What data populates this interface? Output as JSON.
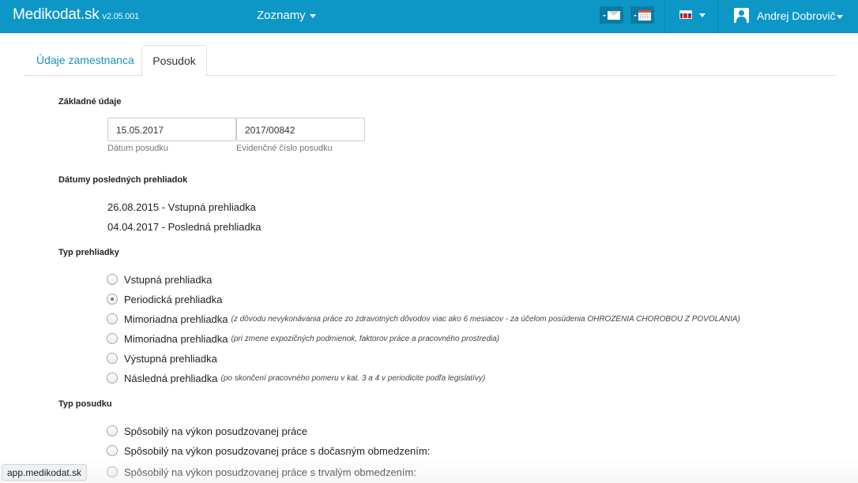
{
  "navbar": {
    "brand": "Medikodat.sk",
    "version": "v2.05.001",
    "menu_label": "Zoznamy",
    "mail_badge": "-",
    "calendar_badge": "-",
    "user_name": "Andrej Dobrovič"
  },
  "tabs": [
    {
      "label": "Údaje zamestnanca",
      "active": false
    },
    {
      "label": "Posudok",
      "active": true
    }
  ],
  "zakladne": {
    "title": "Základné údaje",
    "date_value": "15.05.2017",
    "date_hint": "Dátum posudku",
    "number_value": "2017/00842",
    "number_hint": "Evidenčné číslo posudku"
  },
  "datumy": {
    "title": "Dátumy posledných prehliadok",
    "items": [
      "26.08.2015 - Vstupná prehliadka",
      "04.04.2017 - Posledná prehliadka"
    ]
  },
  "typ_prehliadky": {
    "title": "Typ prehliadky",
    "options": [
      {
        "label": "Vstupná prehliadka",
        "note": "",
        "checked": false
      },
      {
        "label": "Periodická prehliadka",
        "note": "",
        "checked": true
      },
      {
        "label": "Mimoriadna prehliadka",
        "note": "(z dôvodu nevykonávania práce zo zdravotných dôvodov viac ako 6 mesiacov - za účelom posúdenia OHROZENIA CHOROBOU Z POVOLANIA)",
        "checked": false
      },
      {
        "label": "Mimoriadna prehliadka",
        "note": "(pri zmene expozičných podmienok, faktorov práce a pracovného prostredia)",
        "checked": false
      },
      {
        "label": "Výstupná prehliadka",
        "note": "",
        "checked": false
      },
      {
        "label": "Následná prehliadka",
        "note": "(po skončení pracovného pomeru v kat. 3 a 4 v periodicite podľa legislatívy)",
        "checked": false
      }
    ]
  },
  "typ_posudku": {
    "title": "Typ posudku",
    "options": [
      {
        "label": "Spôsobilý na výkon posudzovanej práce",
        "checked": false
      },
      {
        "label": "Spôsobilý na výkon posudzovanej práce s dočasným obmedzením:",
        "checked": false
      },
      {
        "label": "Spôsobilý na výkon posudzovanej práce s trvalým obmedzením:",
        "checked": false
      }
    ]
  },
  "status_url": "app.medikodat.sk"
}
